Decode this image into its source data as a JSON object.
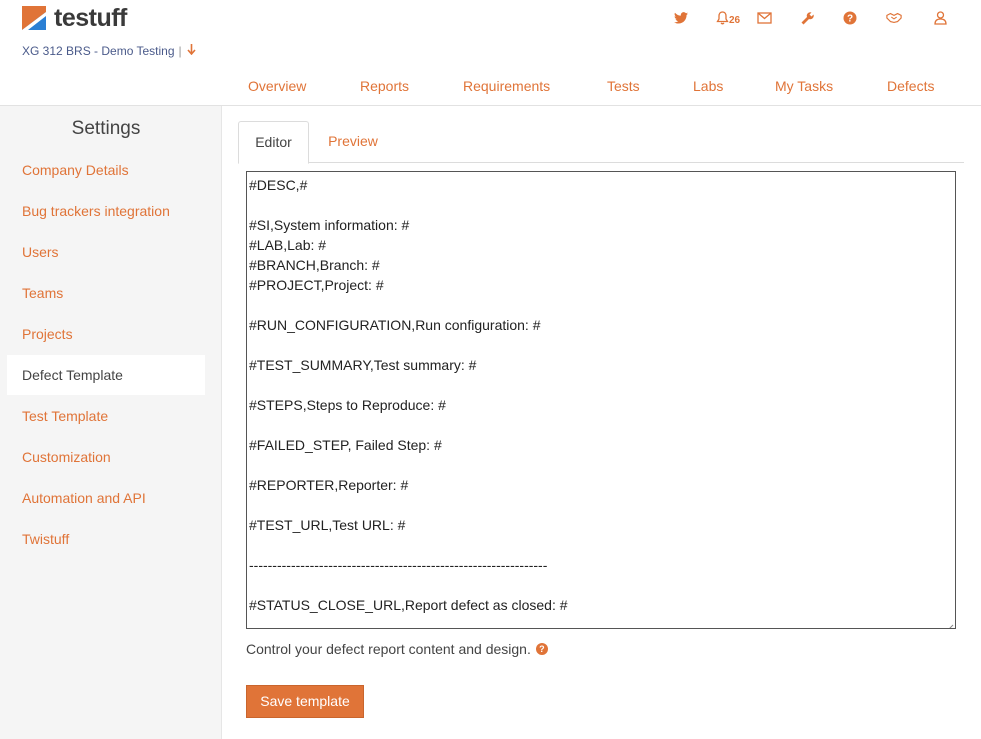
{
  "app": {
    "logo_text": "testuff"
  },
  "header": {
    "project": "XG 312 BRS - Demo Testing",
    "project_separator": "|",
    "notifications_count": "26",
    "icons": [
      "twitter-icon",
      "bell-icon",
      "envelope-icon",
      "wrench-icon",
      "help-icon",
      "handshake-icon",
      "user-icon"
    ]
  },
  "nav": {
    "items": [
      "Overview",
      "Reports",
      "Requirements",
      "Tests",
      "Labs",
      "My Tasks",
      "Defects"
    ]
  },
  "sidebar": {
    "title": "Settings",
    "items": [
      {
        "label": "Company Details"
      },
      {
        "label": "Bug trackers integration"
      },
      {
        "label": "Users"
      },
      {
        "label": "Teams"
      },
      {
        "label": "Projects"
      },
      {
        "label": "Defect Template",
        "active": true
      },
      {
        "label": "Test Template"
      },
      {
        "label": "Customization"
      },
      {
        "label": "Automation and API"
      },
      {
        "label": "Twistuff"
      }
    ]
  },
  "tabs": {
    "editor": "Editor",
    "preview": "Preview"
  },
  "editor": {
    "lines": [
      "#DESC,#",
      "",
      "#SI,System information: #",
      "#LAB,Lab: #",
      "#BRANCH,Branch: #",
      "#PROJECT,Project: #",
      "",
      "#RUN_CONFIGURATION,Run configuration: #",
      "",
      "#TEST_SUMMARY,Test summary: #",
      "",
      "#STEPS,Steps to Reproduce: #",
      "",
      "#FAILED_STEP, Failed Step: #",
      "",
      "#REPORTER,Reporter: #",
      "",
      "#TEST_URL,Test URL: #",
      "",
      "----------------------------------------------------------------",
      "",
      "#STATUS_CLOSE_URL,Report defect as closed: #"
    ]
  },
  "footer": {
    "help_text": "Control your defect report content and design.",
    "save_label": "Save template"
  },
  "colors": {
    "accent": "#e07438",
    "text": "#444444",
    "sidebar_bg": "#f5f5f5"
  }
}
